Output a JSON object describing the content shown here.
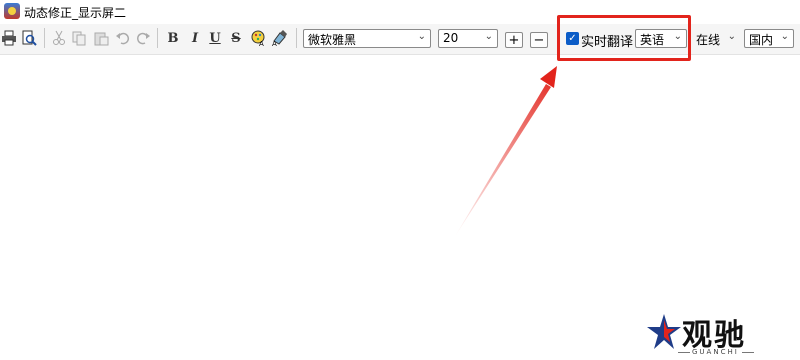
{
  "window": {
    "title": "动态修正_显示屏二"
  },
  "toolbar": {
    "icons": [
      "printer-icon",
      "print-preview-icon",
      "cut-icon",
      "copy-icon",
      "paste-icon",
      "undo-icon",
      "redo-icon",
      "bold-icon",
      "italic-icon",
      "underline-icon",
      "strikethrough-icon",
      "text-color-icon",
      "highlight-icon"
    ],
    "bold_glyph": "B",
    "italic_glyph": "I",
    "underline_glyph": "U",
    "strike_glyph": "S",
    "font_family": "微软雅黑",
    "font_size": "20",
    "increase_label": "+",
    "decrease_label": "−",
    "realtime_translate_label": "实时翻译",
    "realtime_translate_checked": true,
    "language": "英语",
    "mode": "在线",
    "region": "国内"
  },
  "annotation": {
    "highlight_color": "#e2241c"
  },
  "watermark": {
    "brand": "观驰",
    "sub": "GUANCHI"
  }
}
